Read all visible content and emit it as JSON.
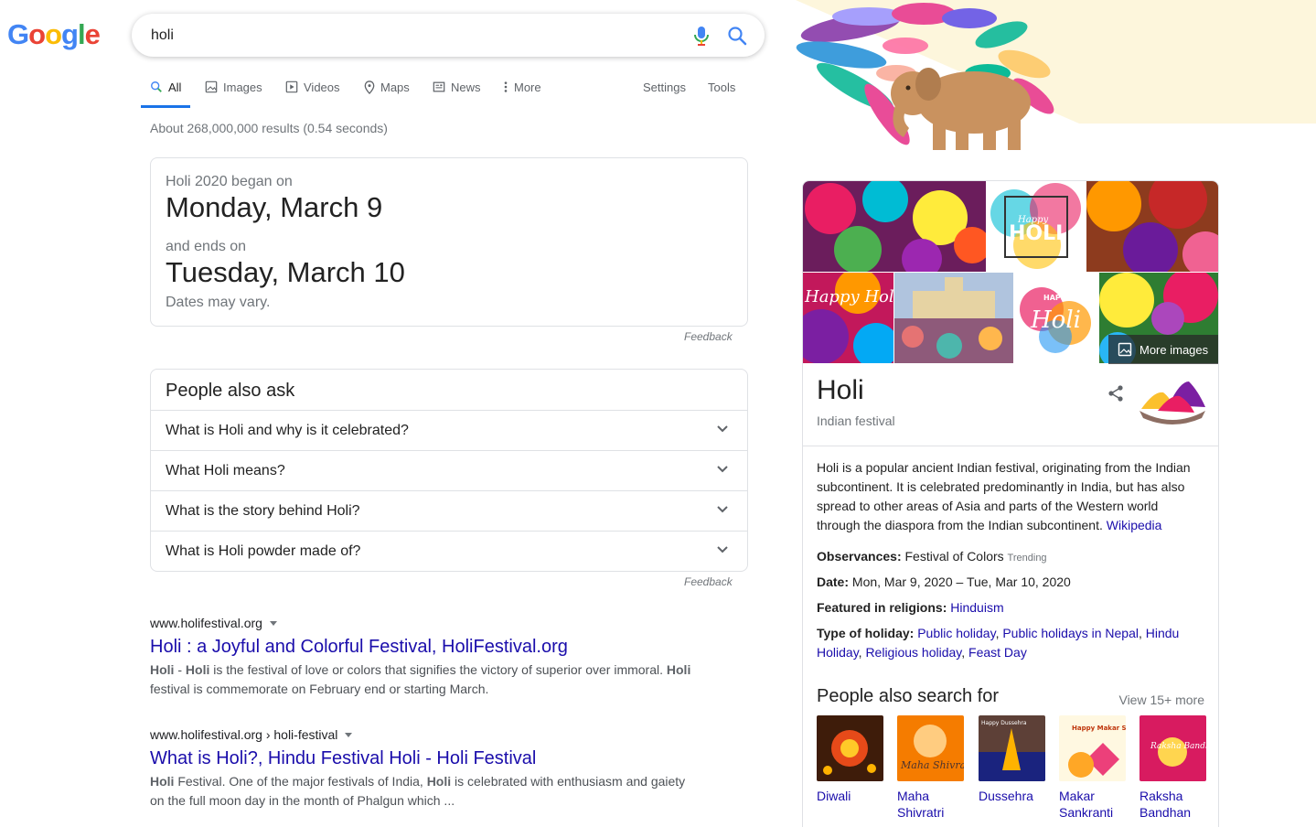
{
  "logo": {
    "letters": [
      "G",
      "o",
      "o",
      "g",
      "l",
      "e"
    ]
  },
  "search": {
    "query": "holi"
  },
  "tabs": [
    {
      "label": "All",
      "icon": "search-icon"
    },
    {
      "label": "Images",
      "icon": "image-icon"
    },
    {
      "label": "Videos",
      "icon": "video-icon"
    },
    {
      "label": "Maps",
      "icon": "map-pin-icon"
    },
    {
      "label": "News",
      "icon": "news-icon"
    },
    {
      "label": "More",
      "icon": "more-vert-icon"
    }
  ],
  "tools": {
    "settings": "Settings",
    "tools": "Tools"
  },
  "stats": "About 268,000,000 results (0.54 seconds)",
  "date_card": {
    "began_label": "Holi 2020 began on",
    "began_date": "Monday, March 9",
    "ends_label": "and ends on",
    "ends_date": "Tuesday, March 10",
    "note": "Dates may vary.",
    "feedback": "Feedback"
  },
  "paa": {
    "title": "People also ask",
    "questions": [
      "What is Holi and why is it celebrated?",
      "What Holi means?",
      "What is the story behind Holi?",
      "What is Holi powder made of?"
    ],
    "feedback": "Feedback"
  },
  "results": [
    {
      "cite": "www.holifestival.org",
      "title": "Holi : a Joyful and Colorful Festival, HoliFestival.org",
      "snippet_parts": [
        "Holi",
        " - ",
        "Holi",
        " is the festival of love or colors that signifies the victory of superior over immoral. ",
        "Holi",
        " festival is commemorate on February end or starting March."
      ]
    },
    {
      "cite": "www.holifestival.org › holi-festival",
      "title": "What is Holi?, Hindu Festival Holi - Holi Festival",
      "snippet_parts": [
        "Holi",
        " Festival. One of the major festivals of India, ",
        "Holi",
        " is celebrated with enthusiasm and gaiety on the full moon day in the month of Phalgun which ..."
      ]
    }
  ],
  "knowledge_panel": {
    "image_texts": {
      "holi_card": "HOLI",
      "happy_small": "Happy",
      "happy_holi": "Happy Holi",
      "happy_holi2_a": "HAPPY",
      "happy_holi2_b": "Holi"
    },
    "more_images": "More images",
    "title": "Holi",
    "subtitle": "Indian festival",
    "description": "Holi is a popular ancient Indian festival, originating from the Indian subcontinent. It is celebrated predominantly in India, but has also spread to other areas of Asia and parts of the Western world through the diaspora from the Indian subcontinent.",
    "source": "Wikipedia",
    "facts": {
      "observances_label": "Observances:",
      "observances_value": "Festival of Colors",
      "observances_badge": "Trending",
      "date_label": "Date:",
      "date_value": "Mon, Mar 9, 2020 – Tue, Mar 10, 2020",
      "religions_label": "Featured in religions:",
      "religions_value": "Hinduism",
      "type_label": "Type of holiday:",
      "type_links": [
        "Public holiday",
        "Public holidays in Nepal",
        "Hindu Holiday",
        "Religious holiday",
        "Feast Day"
      ]
    },
    "people_also_search": {
      "title": "People also search for",
      "view_more": "View 15+ more",
      "items": [
        {
          "label": "Diwali",
          "color": "#c2410c"
        },
        {
          "label": "Maha Shivratri",
          "color": "#f59e0b",
          "img_text": "Maha Shivratri"
        },
        {
          "label": "Dussehra",
          "color": "#78350f",
          "img_text": "Happy Dussehra"
        },
        {
          "label": "Makar Sankranti",
          "color": "#fde68a",
          "img_text": "Happy Makar Sankranti"
        },
        {
          "label": "Raksha Bandhan",
          "color": "#e11d48",
          "img_text": "Raksha Bandhan"
        }
      ]
    }
  },
  "colors": {
    "link": "#1a0dab",
    "accent": "#1a73e8",
    "muted": "#70757a",
    "border": "#dfe1e5"
  }
}
